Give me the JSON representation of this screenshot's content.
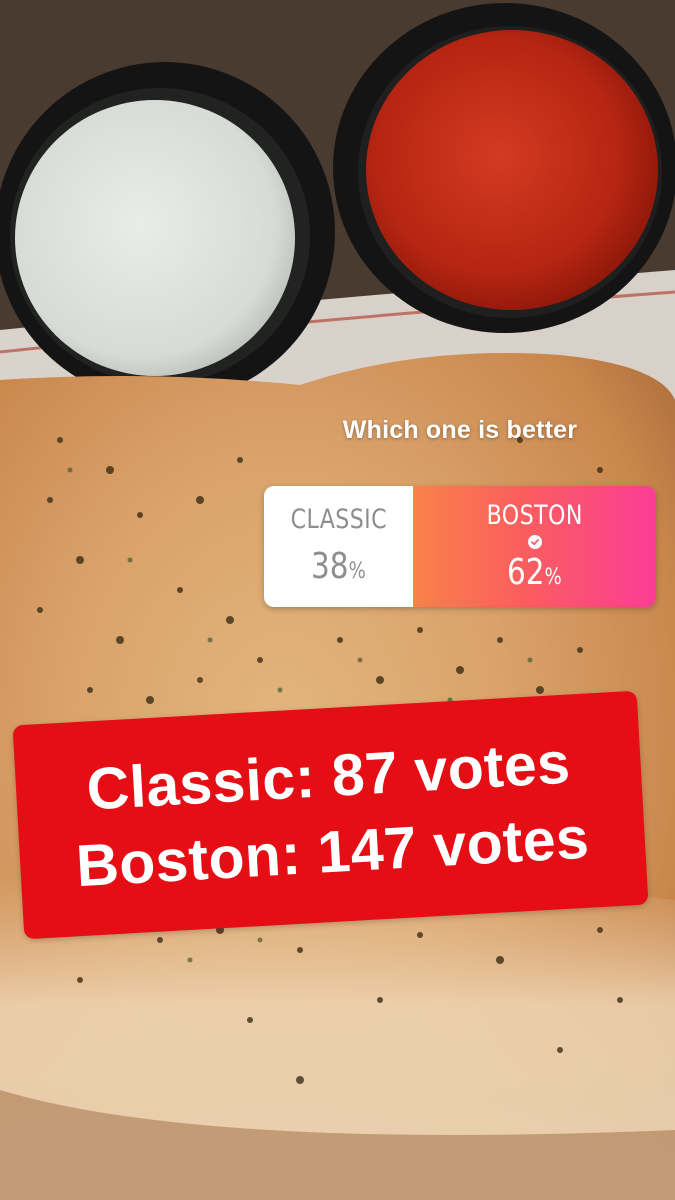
{
  "poll": {
    "question": "Which one is better",
    "options": [
      {
        "label": "CLASSIC",
        "percent": "38",
        "percent_sign": "%",
        "selected": false
      },
      {
        "label": "BOSTON",
        "percent": "62",
        "percent_sign": "%",
        "selected": true
      }
    ],
    "gradient_colors": [
      "#f9824a",
      "#fa5e5e",
      "#fb3d96"
    ]
  },
  "sticker": {
    "line1": "Classic: 87 votes",
    "line2": "Boston: 147 votes",
    "background_color": "#e40e14"
  },
  "photo": {
    "subject_icon": "calzone-photo",
    "items": [
      "ranch-dip-cup-icon",
      "marinara-dip-cup-icon",
      "calzone-icon"
    ]
  }
}
